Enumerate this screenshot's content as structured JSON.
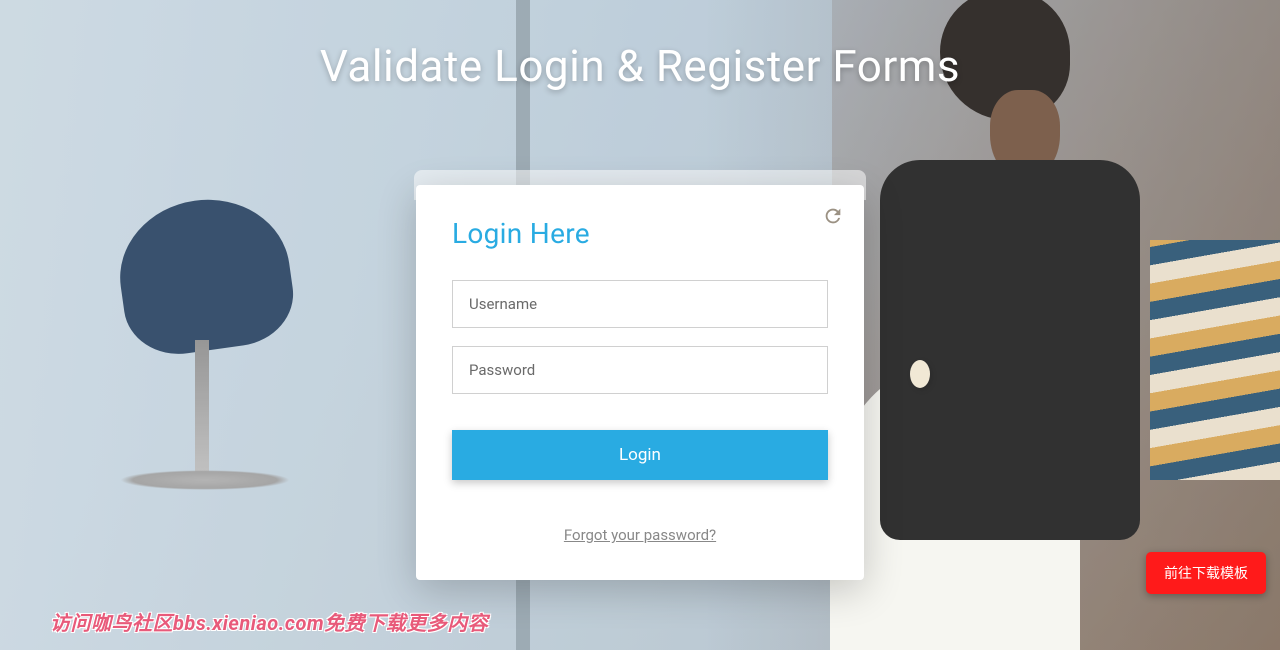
{
  "page": {
    "title": "Validate Login & Register Forms"
  },
  "card": {
    "title": "Login Here",
    "username_placeholder": "Username",
    "password_placeholder": "Password",
    "login_button_label": "Login",
    "forgot_link_label": "Forgot your password?"
  },
  "download_button_label": "前往下载模板",
  "watermark": {
    "part1": "访问咖鸟社区",
    "part2": "bbs.xieniao.com",
    "part3": "免费下载更多内容"
  },
  "colors": {
    "accent": "#29abe2",
    "download_button": "#ff1a1a"
  }
}
